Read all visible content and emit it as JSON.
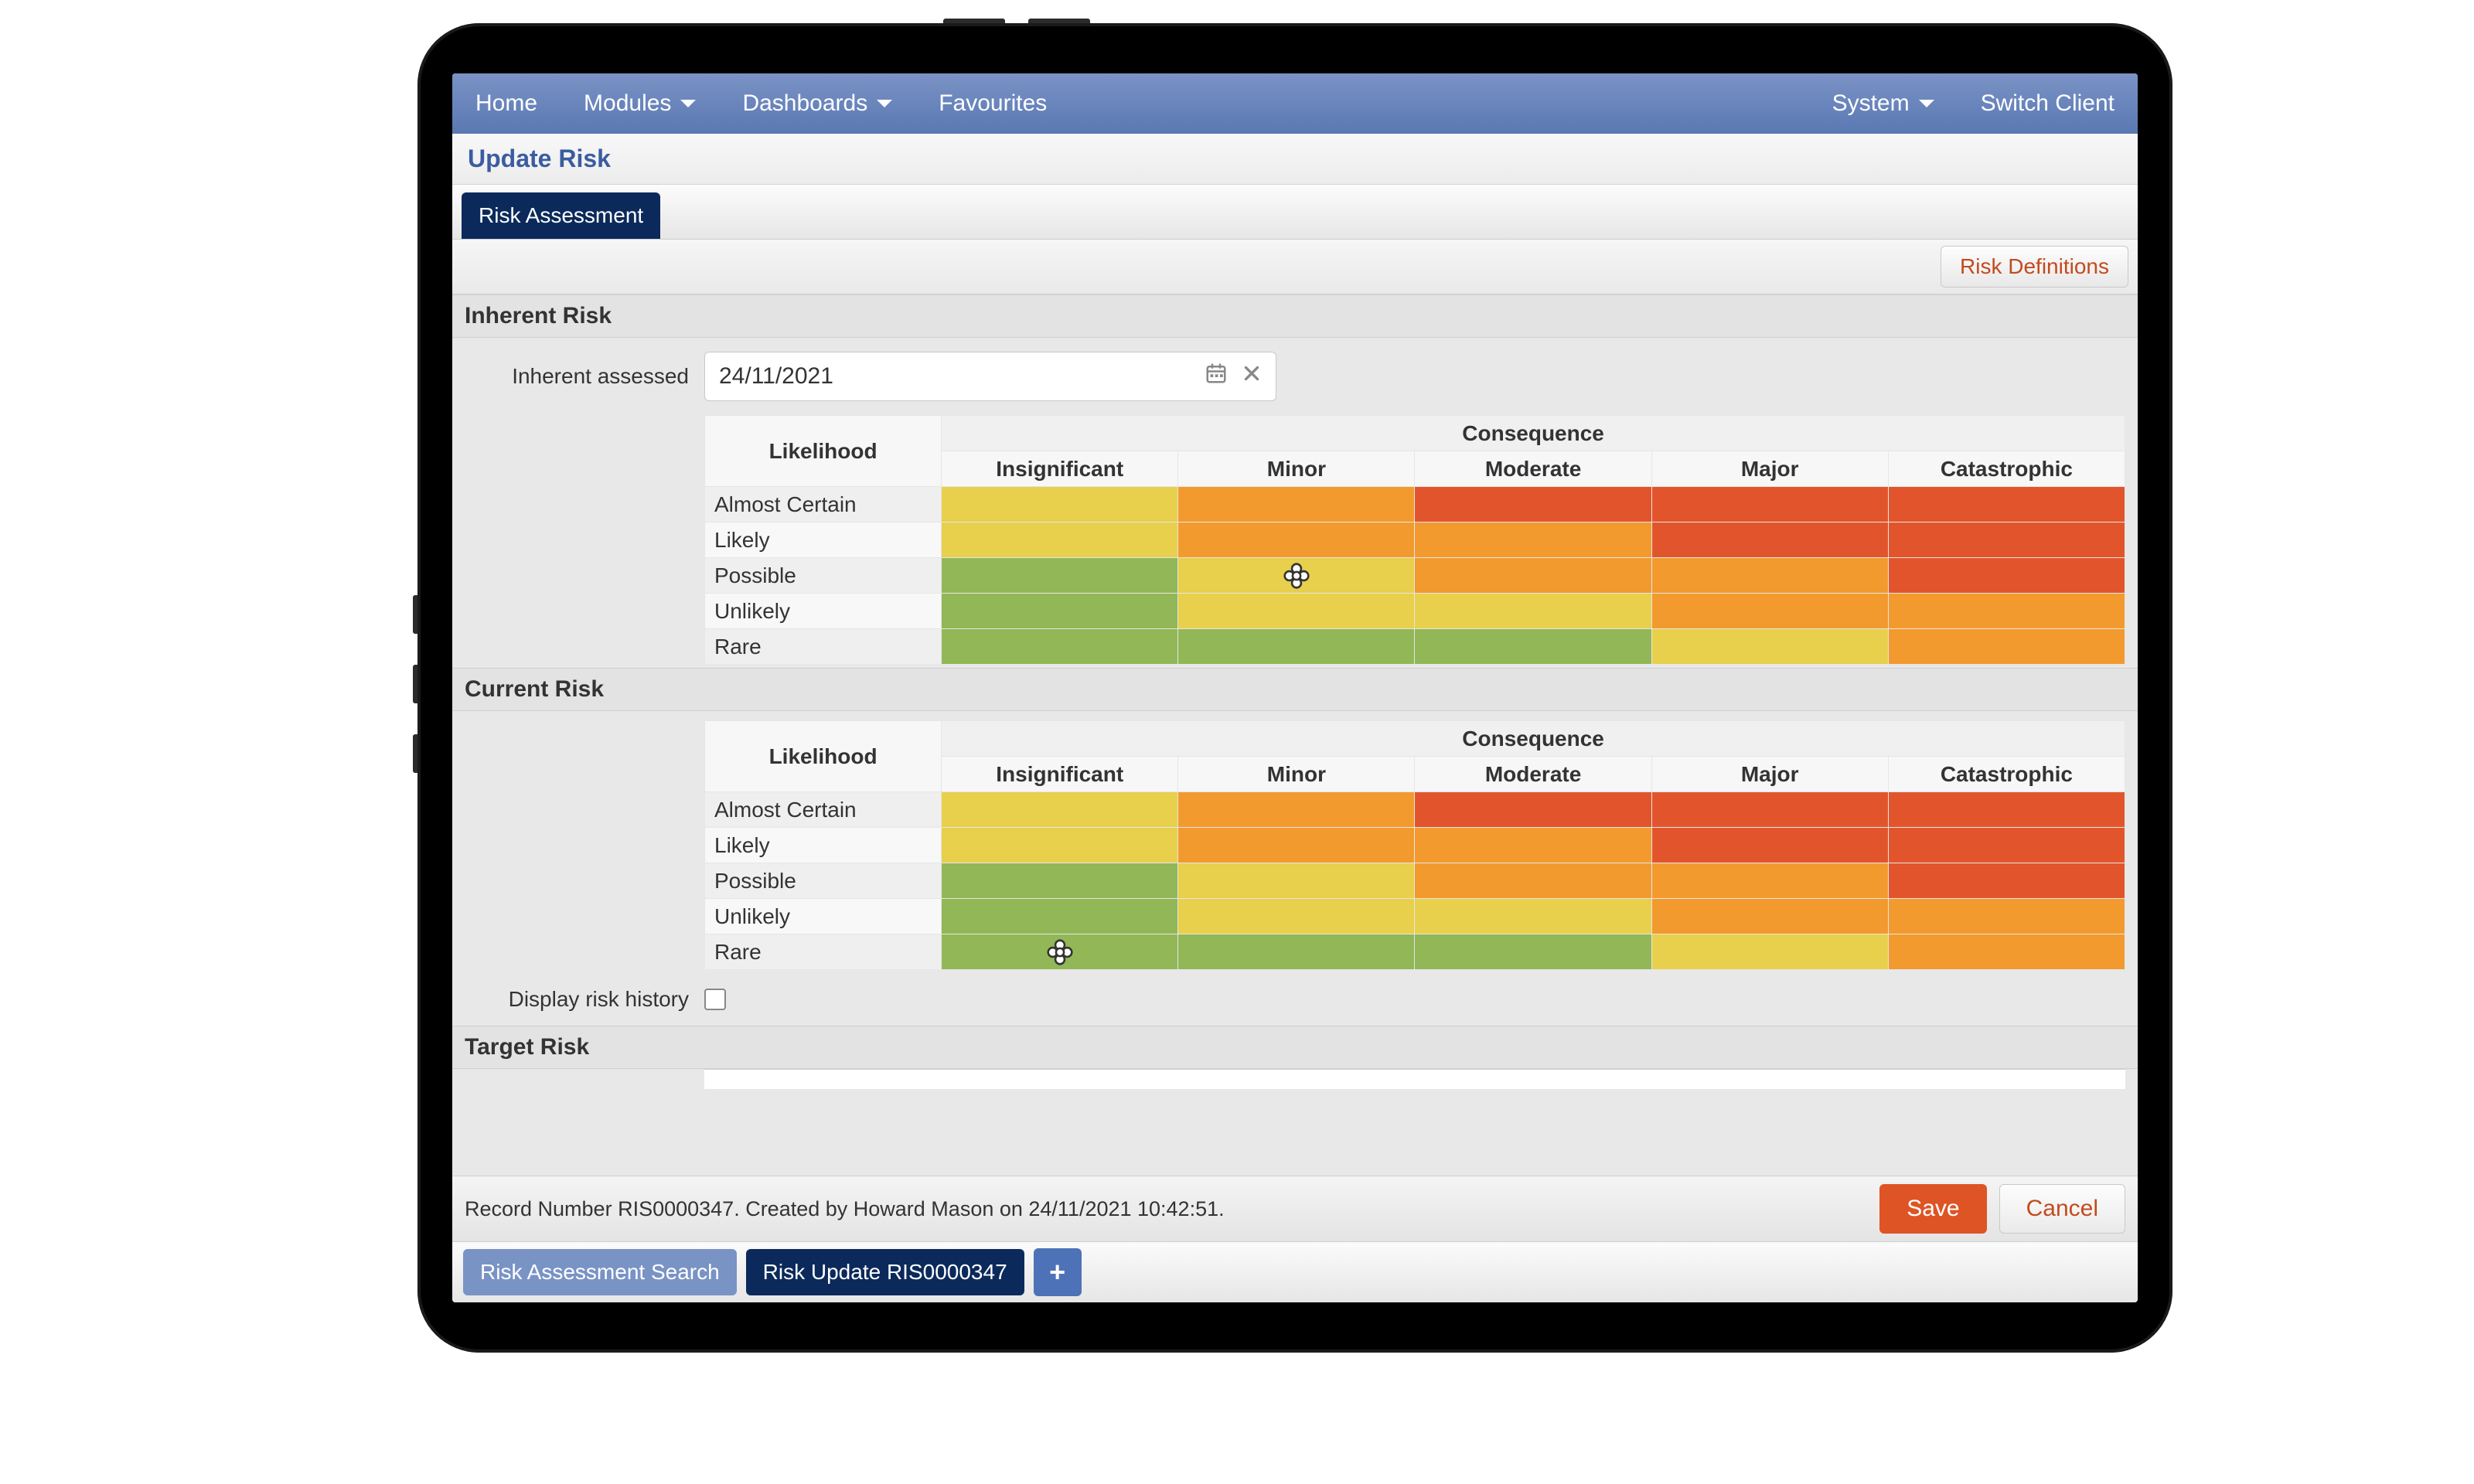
{
  "nav": {
    "left": [
      "Home",
      "Modules",
      "Dashboards",
      "Favourites"
    ],
    "left_dropdown": [
      false,
      true,
      true,
      false
    ],
    "right": [
      "System",
      "Switch Client"
    ],
    "right_dropdown": [
      true,
      false
    ]
  },
  "page_title": "Update Risk",
  "active_tab": "Risk Assessment",
  "risk_definitions_btn": "Risk Definitions",
  "inherent_assessed_label": "Inherent assessed",
  "inherent_assessed_value": "24/11/2021",
  "display_history_label": "Display risk history",
  "matrix": {
    "consequence_label": "Consequence",
    "likelihood_label": "Likelihood",
    "consequence_cols": [
      "Insignificant",
      "Minor",
      "Moderate",
      "Major",
      "Catastrophic"
    ],
    "likelihood_rows": [
      "Almost Certain",
      "Likely",
      "Possible",
      "Unlikely",
      "Rare"
    ],
    "colors": [
      [
        "y",
        "o",
        "r",
        "r",
        "r"
      ],
      [
        "y",
        "o",
        "o",
        "r",
        "r"
      ],
      [
        "g",
        "y",
        "o",
        "o",
        "r"
      ],
      [
        "g",
        "y",
        "y",
        "o",
        "o"
      ],
      [
        "g",
        "g",
        "g",
        "y",
        "o"
      ]
    ]
  },
  "sections": {
    "inherent": "Inherent Risk",
    "current": "Current Risk",
    "target": "Target Risk"
  },
  "inherent_marker": {
    "row": 2,
    "col": 1
  },
  "current_marker": {
    "row": 4,
    "col": 0
  },
  "record_text": "Record Number RIS0000347. Created by Howard Mason on 24/11/2021 10:42:51.",
  "save_label": "Save",
  "cancel_label": "Cancel",
  "bottom_tabs": {
    "search": "Risk Assessment Search",
    "update": "Risk Update RIS0000347"
  },
  "icons": {
    "calendar": "calendar-icon",
    "clear": "close-icon",
    "plus": "plus-icon"
  }
}
